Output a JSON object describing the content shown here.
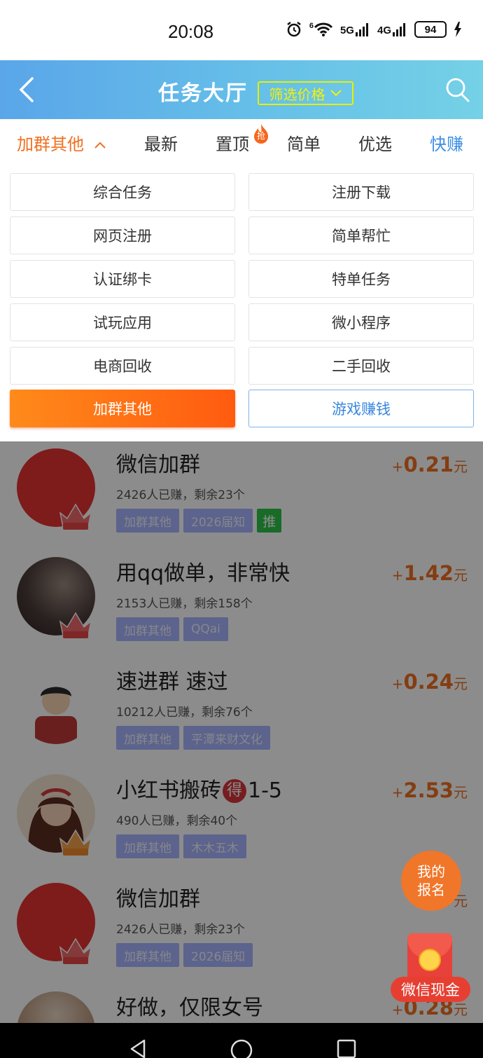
{
  "status_bar": {
    "time": "20:08",
    "network_a": "5G",
    "network_b": "4G",
    "wifi_label": "6",
    "battery": "94"
  },
  "header": {
    "title": "任务大厅",
    "filter_label": "筛选价格",
    "colors": {
      "gradient_start": "#5aa6e9",
      "gradient_end": "#74d1e6",
      "filter": "#f3f300"
    }
  },
  "tabs": [
    {
      "label": "加群其他",
      "active": true
    },
    {
      "label": "最新"
    },
    {
      "label": "置顶",
      "badge": "抢"
    },
    {
      "label": "简单"
    },
    {
      "label": "优选"
    },
    {
      "label": "快赚"
    }
  ],
  "categories": [
    {
      "label": "综合任务"
    },
    {
      "label": "注册下载"
    },
    {
      "label": "网页注册"
    },
    {
      "label": "简单帮忙"
    },
    {
      "label": "认证绑卡"
    },
    {
      "label": "特单任务"
    },
    {
      "label": "试玩应用"
    },
    {
      "label": "微小程序"
    },
    {
      "label": "电商回收"
    },
    {
      "label": "二手回收"
    },
    {
      "label": "加群其他",
      "selected": true
    },
    {
      "label": "游戏赚钱"
    }
  ],
  "tasks": [
    {
      "title": "微信加群",
      "meta": "2426人已赚，剩余23个",
      "tags": [
        "加群其他",
        "2026届知",
        "推"
      ],
      "plus": "+",
      "amount": "0.21",
      "unit": "元",
      "avatar_icon": "red-circle-avatar",
      "badge": "年卡"
    },
    {
      "title": "用qq做单，非常快",
      "meta": "2153人已赚，剩余158个",
      "tags": [
        "加群其他",
        "QQai"
      ],
      "plus": "+",
      "amount": "1.42",
      "unit": "元",
      "avatar_icon": "silhouette-avatar",
      "badge": "年卡"
    },
    {
      "title": "速进群 速过",
      "meta": "10212人已赚，剩余76个",
      "tags": [
        "加群其他",
        "平潭来财文化"
      ],
      "plus": "+",
      "amount": "0.24",
      "unit": "元",
      "avatar_icon": "cartoon-boy-avatar",
      "badge": ""
    },
    {
      "title_before": "小红书搬砖",
      "title_badge": "得",
      "title_after": "1-5",
      "meta": "490人已赚，剩余40个",
      "tags": [
        "加群其他",
        "木木五木"
      ],
      "plus": "+",
      "amount": "2.53",
      "unit": "元",
      "avatar_icon": "cartoon-girl-avatar",
      "badge": "半年"
    },
    {
      "title": "微信加群",
      "meta": "2426人已赚，剩余23个",
      "tags": [
        "加群其他",
        "2026届知"
      ],
      "plus": "+",
      "amount": "",
      "unit": "元",
      "avatar_icon": "red-circle-avatar",
      "badge": "年卡"
    },
    {
      "title": "好做，仅限女号",
      "plus": "+",
      "amount": "0.28",
      "unit": "元",
      "avatar_icon": "photo-avatar"
    }
  ],
  "floating": {
    "signup_line1": "我的",
    "signup_line2": "报名",
    "cash_label": "微信现金"
  }
}
